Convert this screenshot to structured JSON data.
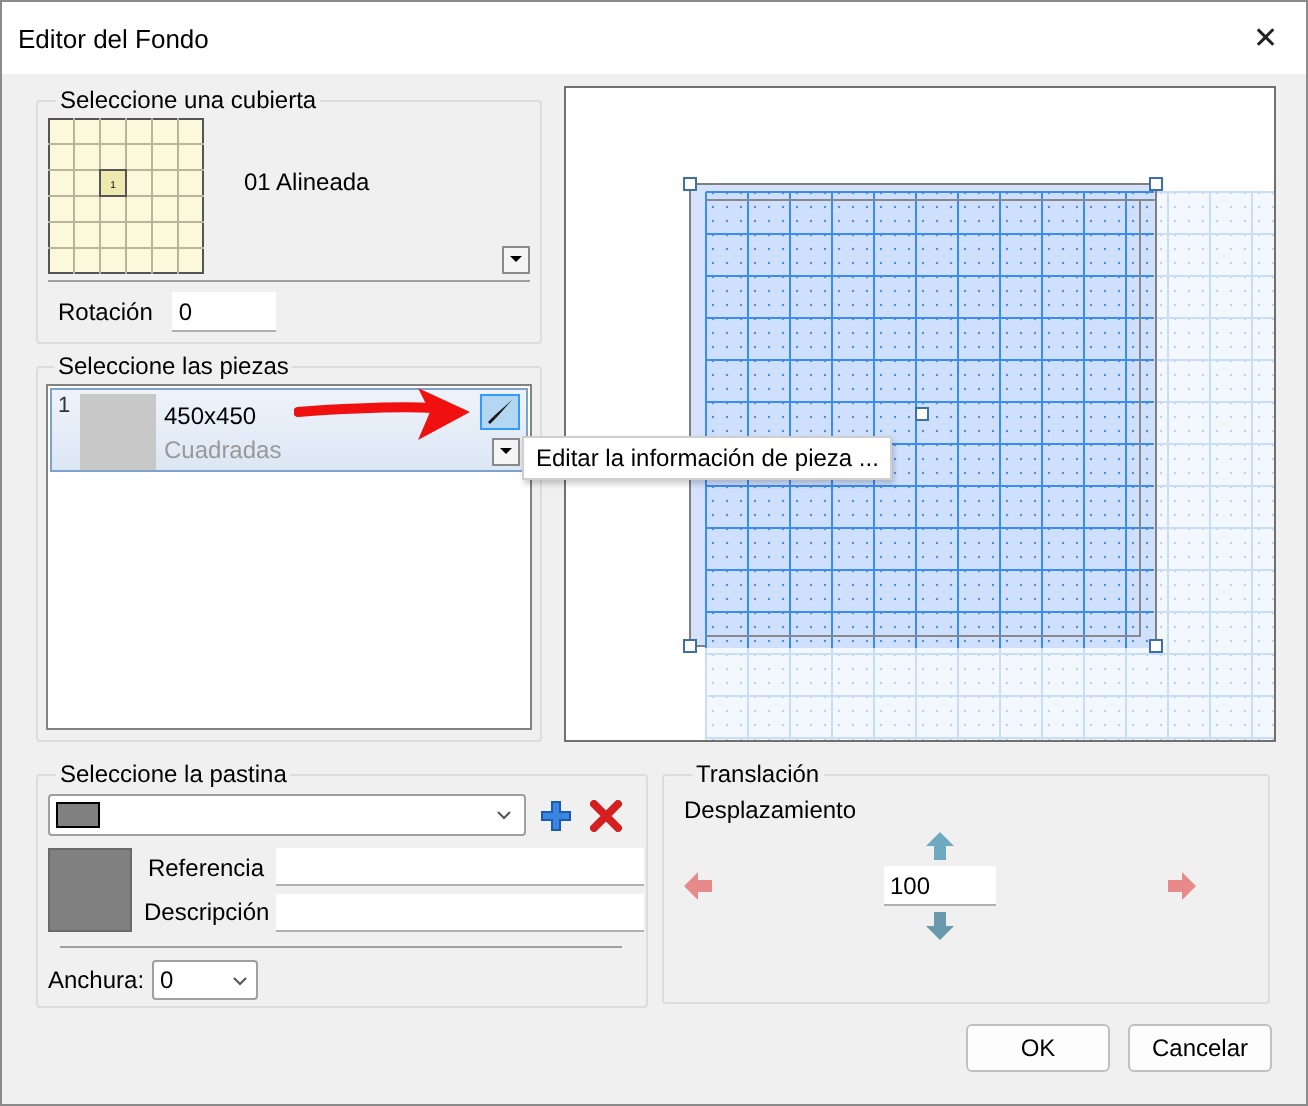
{
  "window": {
    "title": "Editor del Fondo",
    "close": "✕"
  },
  "cubierta": {
    "legend": "Seleccione una cubierta",
    "thumbnail_label": "1",
    "name": "01 Alineada",
    "rotation_label": "Rotación",
    "rotation_value": "0"
  },
  "piezas": {
    "legend": "Seleccione las piezas",
    "items": [
      {
        "index": "1",
        "size": "450x450",
        "type": "Cuadradas",
        "selected": true
      }
    ],
    "tooltip": "Editar la información de pieza ..."
  },
  "pastina": {
    "legend": "Seleccione la pastina",
    "reference_label": "Referencia",
    "description_label": "Descripción",
    "width_label": "Anchura:",
    "width_value": "0"
  },
  "translacion": {
    "legend": "Translación",
    "label": "Desplazamiento",
    "value": "100"
  },
  "buttons": [
    "OK",
    "Cancelar"
  ]
}
